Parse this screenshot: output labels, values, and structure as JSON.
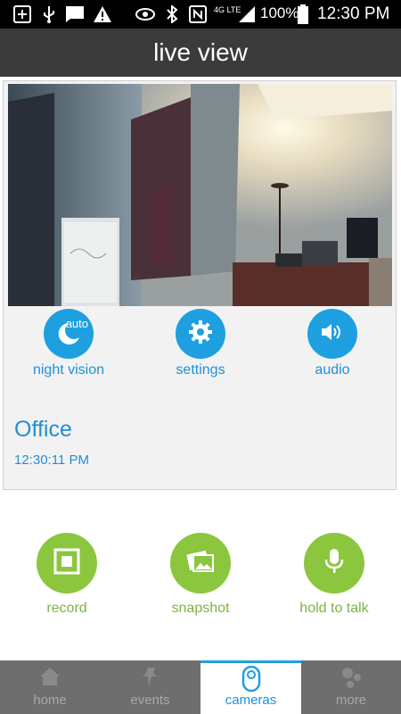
{
  "status_bar": {
    "battery_percent": "100%",
    "clock": "12:30 PM",
    "network_label": "4G LTE",
    "icons": [
      "add-box-icon",
      "usb-icon",
      "message-icon",
      "warning-icon",
      "eye-icon",
      "bluetooth-icon",
      "nfc-icon",
      "signal-icon",
      "battery-icon"
    ]
  },
  "header": {
    "title": "live view"
  },
  "camera_controls": [
    {
      "label": "night vision",
      "icon": "moon-icon",
      "badge": "auto"
    },
    {
      "label": "settings",
      "icon": "gear-icon"
    },
    {
      "label": "audio",
      "icon": "speaker-icon"
    }
  ],
  "camera": {
    "name": "Office",
    "timestamp": "12:30:11 PM"
  },
  "actions": [
    {
      "label": "record",
      "icon": "record-icon"
    },
    {
      "label": "snapshot",
      "icon": "photo-icon"
    },
    {
      "label": "hold to talk",
      "icon": "microphone-icon"
    }
  ],
  "tabs": [
    {
      "label": "home",
      "icon": "home-icon",
      "active": false
    },
    {
      "label": "events",
      "icon": "pin-icon",
      "active": false
    },
    {
      "label": "cameras",
      "icon": "camera-icon",
      "active": true
    },
    {
      "label": "more",
      "icon": "more-icon",
      "active": false
    }
  ],
  "colors": {
    "accent_blue": "#1ea0e0",
    "action_green": "#8cc63f",
    "header_bg": "#3b3b3b",
    "tab_bg": "#6e6e6e"
  }
}
